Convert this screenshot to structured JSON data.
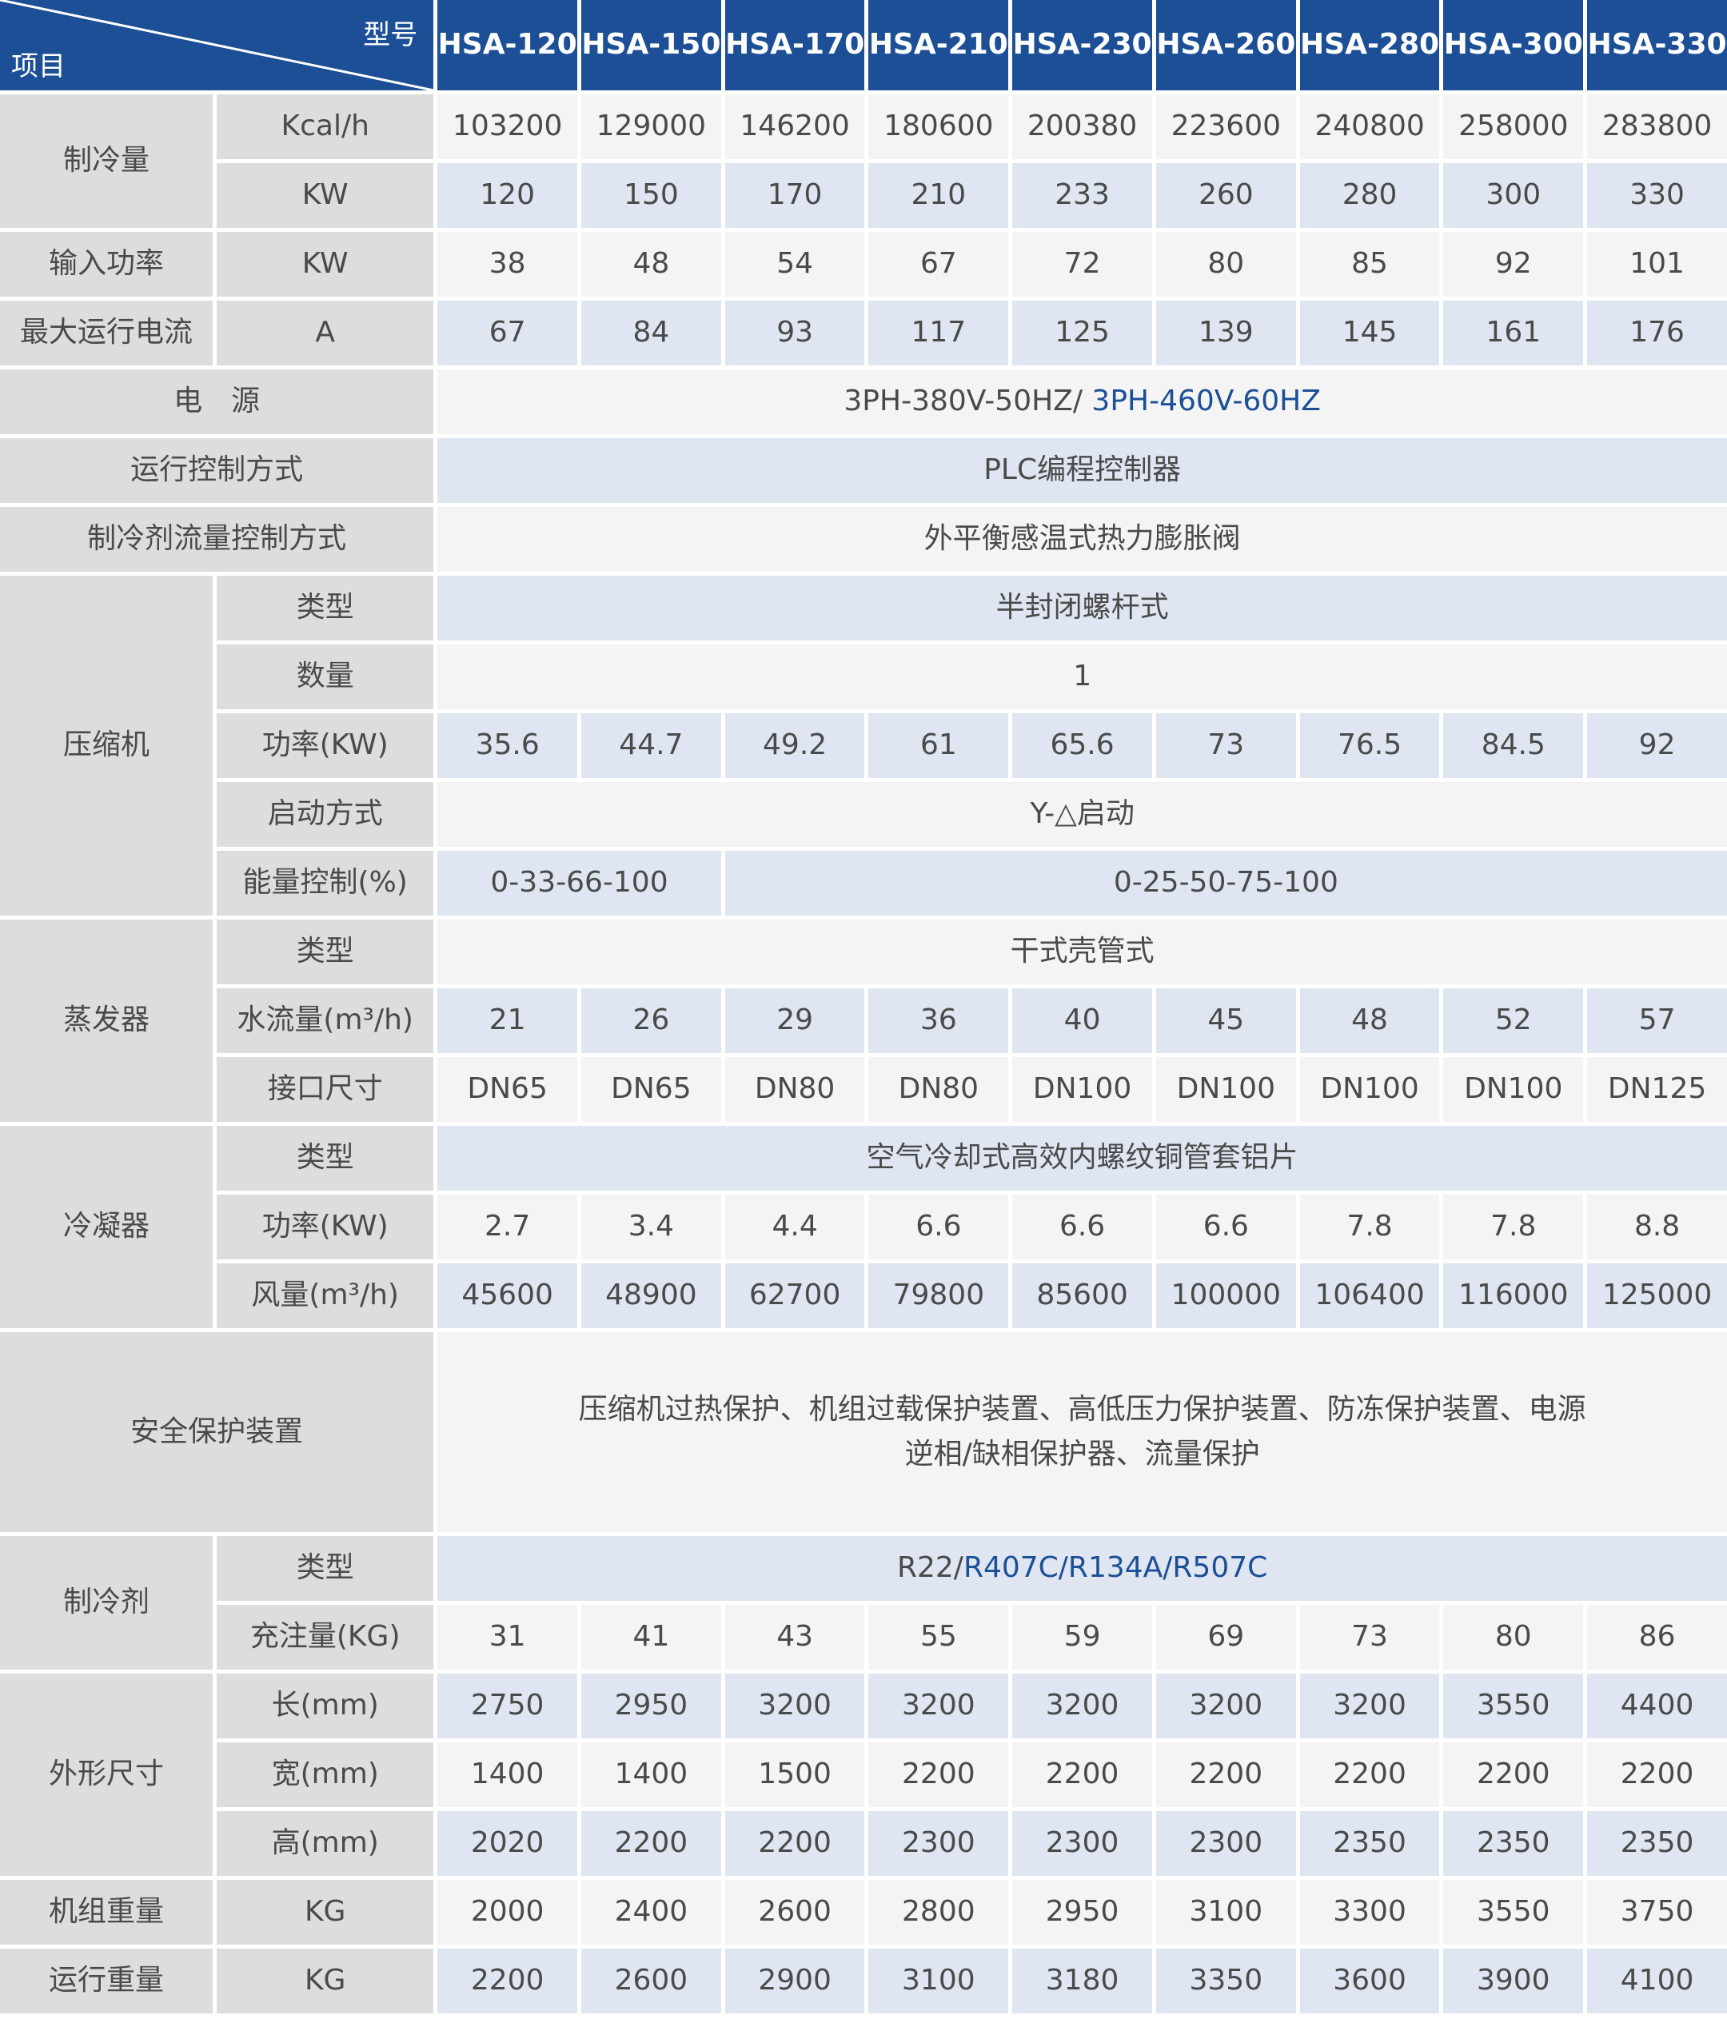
{
  "header": {
    "model_label": "型号",
    "item_label": "项目",
    "models": [
      "HSA-120",
      "HSA-150",
      "HSA-170",
      "HSA-210",
      "HSA-230",
      "HSA-260",
      "HSA-280",
      "HSA-300",
      "HSA-330"
    ]
  },
  "cooling": {
    "label": "制冷量",
    "kcal_unit": "Kcal/h",
    "kcal_values": [
      "103200",
      "129000",
      "146200",
      "180600",
      "200380",
      "223600",
      "240800",
      "258000",
      "283800"
    ],
    "kw_unit": "KW",
    "kw_values": [
      "120",
      "150",
      "170",
      "210",
      "233",
      "260",
      "280",
      "300",
      "330"
    ]
  },
  "input_power": {
    "label": "输入功率",
    "unit": "KW",
    "values": [
      "38",
      "48",
      "54",
      "67",
      "72",
      "80",
      "85",
      "92",
      "101"
    ]
  },
  "max_current": {
    "label": "最大运行电流",
    "unit": "A",
    "values": [
      "67",
      "84",
      "93",
      "117",
      "125",
      "139",
      "145",
      "161",
      "176"
    ]
  },
  "power_supply": {
    "label": "电　源",
    "value_main": "3PH-380V-50HZ/ ",
    "value_alt": "3PH-460V-60HZ"
  },
  "control": {
    "label": "运行控制方式",
    "value": "PLC编程控制器"
  },
  "refrigerant_flow": {
    "label": "制冷剂流量控制方式",
    "value": "外平衡感温式热力膨胀阀"
  },
  "compressor": {
    "label": "压缩机",
    "type_label": "类型",
    "type_value": "半封闭螺杆式",
    "qty_label": "数量",
    "qty_value": "1",
    "power_label": "功率(KW)",
    "power_values": [
      "35.6",
      "44.7",
      "49.2",
      "61",
      "65.6",
      "73",
      "76.5",
      "84.5",
      "92"
    ],
    "start_label": "启动方式",
    "start_value": "Y-△启动",
    "energy_label": "能量控制(%)",
    "energy_value_a": "0-33-66-100",
    "energy_value_b": "0-25-50-75-100"
  },
  "evaporator": {
    "label": "蒸发器",
    "type_label": "类型",
    "type_value": "干式壳管式",
    "flow_label": "水流量(m³/h)",
    "flow_values": [
      "21",
      "26",
      "29",
      "36",
      "40",
      "45",
      "48",
      "52",
      "57"
    ],
    "port_label": "接口尺寸",
    "port_values": [
      "DN65",
      "DN65",
      "DN80",
      "DN80",
      "DN100",
      "DN100",
      "DN100",
      "DN100",
      "DN125"
    ]
  },
  "condenser": {
    "label": "冷凝器",
    "type_label": "类型",
    "type_value": "空气冷却式高效内螺纹铜管套铝片",
    "power_label": "功率(KW)",
    "power_values": [
      "2.7",
      "3.4",
      "4.4",
      "6.6",
      "6.6",
      "6.6",
      "7.8",
      "7.8",
      "8.8"
    ],
    "air_label": "风量(m³/h)",
    "air_values": [
      "45600",
      "48900",
      "62700",
      "79800",
      "85600",
      "100000",
      "106400",
      "116000",
      "125000"
    ]
  },
  "safety": {
    "label": "安全保护装置",
    "value": "压缩机过热保护、机组过载保护装置、高低压力保护装置、防冻保护装置、电源逆相/缺相保护器、流量保护"
  },
  "refrigerant": {
    "label": "制冷剂",
    "type_label": "类型",
    "type_main": "R22/",
    "type_alt": "R407C/R134A/R507C",
    "charge_label": "充注量(KG)",
    "charge_values": [
      "31",
      "41",
      "43",
      "55",
      "59",
      "69",
      "73",
      "80",
      "86"
    ]
  },
  "dimensions": {
    "label": "外形尺寸",
    "length_label": "长(mm)",
    "length_values": [
      "2750",
      "2950",
      "3200",
      "3200",
      "3200",
      "3200",
      "3200",
      "3550",
      "4400"
    ],
    "width_label": "宽(mm)",
    "width_values": [
      "1400",
      "1400",
      "1500",
      "2200",
      "2200",
      "2200",
      "2200",
      "2200",
      "2200"
    ],
    "height_label": "高(mm)",
    "height_values": [
      "2020",
      "2200",
      "2200",
      "2300",
      "2300",
      "2300",
      "2350",
      "2350",
      "2350"
    ]
  },
  "unit_weight": {
    "label": "机组重量",
    "unit": "KG",
    "values": [
      "2000",
      "2400",
      "2600",
      "2800",
      "2950",
      "3100",
      "3300",
      "3550",
      "3750"
    ]
  },
  "operating_weight": {
    "label": "运行重量",
    "unit": "KG",
    "values": [
      "2200",
      "2600",
      "2900",
      "3100",
      "3180",
      "3350",
      "3600",
      "3900",
      "4100"
    ]
  }
}
